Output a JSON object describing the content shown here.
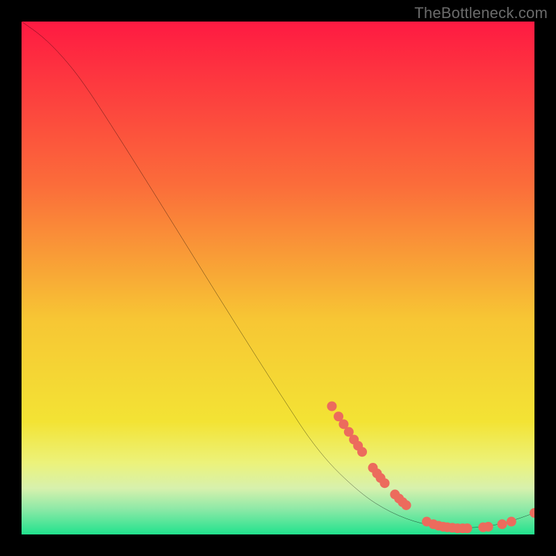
{
  "watermark": "TheBottleneck.com",
  "colors": {
    "gradient_top": "#fe1a42",
    "gradient_mid": "#f4d432",
    "gradient_bottom_band_start": "#e9f3a0",
    "gradient_bottom_band_end": "#21e28d",
    "curve": "#000000",
    "markers": "#ec6b5d",
    "background": "#000000",
    "watermark": "#6b6b6b"
  },
  "chart_data": {
    "type": "line",
    "title": "",
    "xlabel": "",
    "ylabel": "",
    "xlim": [
      0,
      100
    ],
    "ylim": [
      0,
      100
    ],
    "grid": false,
    "legend": false,
    "curve": [
      {
        "x": 0.0,
        "y": 100.0
      },
      {
        "x": 4.0,
        "y": 97.2
      },
      {
        "x": 8.0,
        "y": 93.2
      },
      {
        "x": 12.0,
        "y": 88.2
      },
      {
        "x": 18.0,
        "y": 79.0
      },
      {
        "x": 26.0,
        "y": 66.3
      },
      {
        "x": 34.0,
        "y": 53.4
      },
      {
        "x": 42.0,
        "y": 40.6
      },
      {
        "x": 50.0,
        "y": 28.0
      },
      {
        "x": 58.0,
        "y": 15.8
      },
      {
        "x": 66.0,
        "y": 8.0
      },
      {
        "x": 72.0,
        "y": 4.2
      },
      {
        "x": 78.0,
        "y": 2.0
      },
      {
        "x": 84.0,
        "y": 1.2
      },
      {
        "x": 90.0,
        "y": 1.4
      },
      {
        "x": 95.0,
        "y": 2.4
      },
      {
        "x": 100.0,
        "y": 4.2
      }
    ],
    "markers": [
      {
        "x": 60.5,
        "y": 25.0
      },
      {
        "x": 61.8,
        "y": 23.0
      },
      {
        "x": 62.8,
        "y": 21.5
      },
      {
        "x": 63.8,
        "y": 20.0
      },
      {
        "x": 64.8,
        "y": 18.5
      },
      {
        "x": 65.6,
        "y": 17.3
      },
      {
        "x": 66.4,
        "y": 16.1
      },
      {
        "x": 68.5,
        "y": 13.0
      },
      {
        "x": 69.3,
        "y": 11.9
      },
      {
        "x": 70.0,
        "y": 11.0
      },
      {
        "x": 70.8,
        "y": 10.0
      },
      {
        "x": 72.8,
        "y": 7.8
      },
      {
        "x": 73.6,
        "y": 7.0
      },
      {
        "x": 74.3,
        "y": 6.3
      },
      {
        "x": 75.0,
        "y": 5.7
      },
      {
        "x": 79.0,
        "y": 2.5
      },
      {
        "x": 80.3,
        "y": 2.0
      },
      {
        "x": 81.3,
        "y": 1.7
      },
      {
        "x": 82.2,
        "y": 1.5
      },
      {
        "x": 83.0,
        "y": 1.4
      },
      {
        "x": 84.0,
        "y": 1.3
      },
      {
        "x": 85.0,
        "y": 1.2
      },
      {
        "x": 86.0,
        "y": 1.2
      },
      {
        "x": 86.9,
        "y": 1.2
      },
      {
        "x": 90.0,
        "y": 1.4
      },
      {
        "x": 91.0,
        "y": 1.5
      },
      {
        "x": 93.7,
        "y": 2.0
      },
      {
        "x": 95.5,
        "y": 2.5
      },
      {
        "x": 100.0,
        "y": 4.2
      }
    ]
  }
}
